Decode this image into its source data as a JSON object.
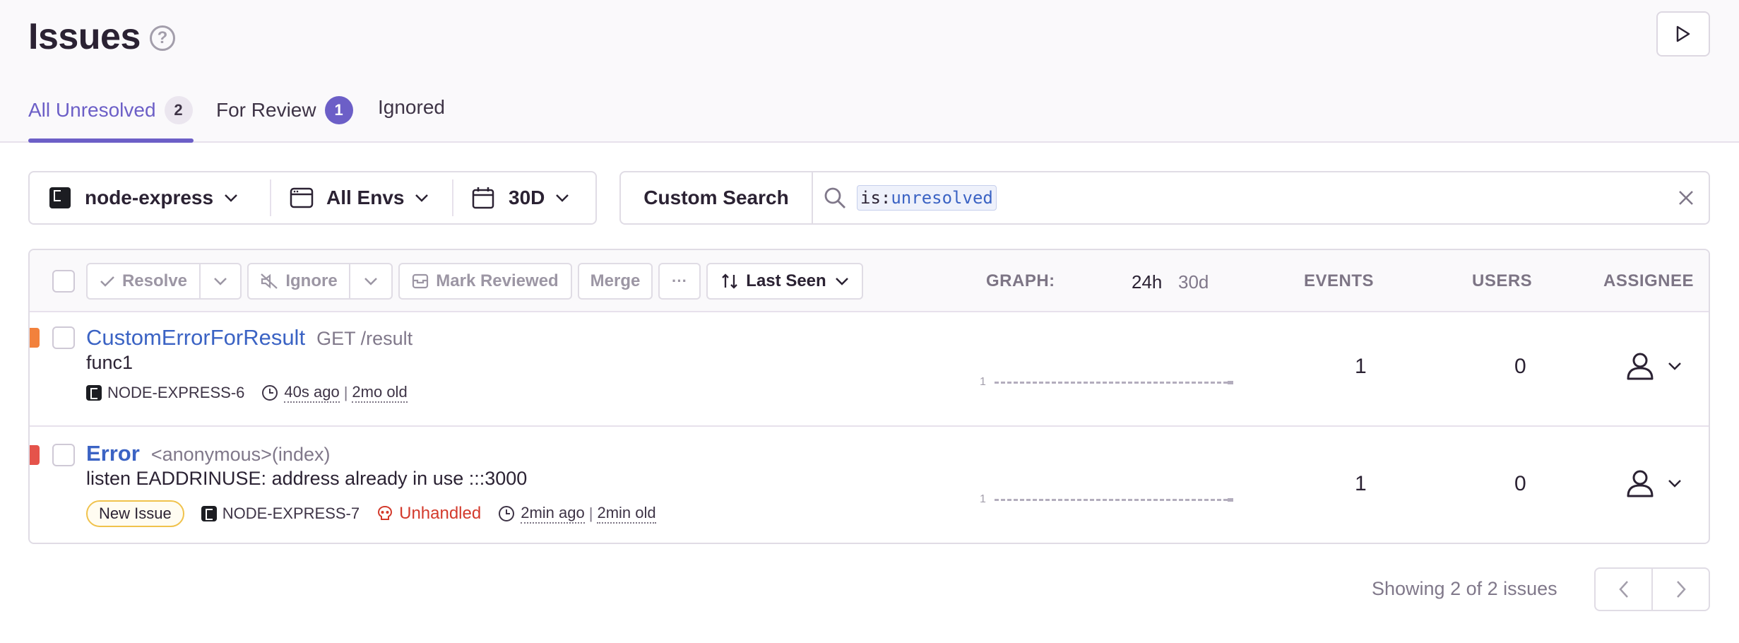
{
  "header": {
    "title": "Issues",
    "help_icon": "?",
    "tabs": [
      {
        "label": "All Unresolved",
        "count": "2"
      },
      {
        "label": "For Review",
        "count": "1"
      },
      {
        "label": "Ignored"
      }
    ]
  },
  "filters": {
    "project": "node-express",
    "environment": "All Envs",
    "period": "30D"
  },
  "search": {
    "custom_label": "Custom Search",
    "token_key": "is:",
    "token_value": "unresolved"
  },
  "toolbar": {
    "resolve": "Resolve",
    "ignore": "Ignore",
    "mark_reviewed": "Mark Reviewed",
    "merge": "Merge",
    "more": "···",
    "sort": "Last Seen",
    "graph_label": "GRAPH:",
    "graph_24h": "24h",
    "graph_30d": "30d",
    "col_events": "EVENTS",
    "col_users": "USERS",
    "col_assignee": "ASSIGNEE"
  },
  "issues": [
    {
      "title": "CustomErrorForResult",
      "subtitle": "GET /result",
      "message": "func1",
      "short_id": "NODE-EXPRESS-6",
      "last_seen": "40s ago",
      "age": "2mo old",
      "graph_max": "1",
      "events": "1",
      "users": "0",
      "level_color": "#f2813c"
    },
    {
      "title": "Error",
      "subtitle": "<anonymous>(index)",
      "message": "listen EADDRINUSE: address already in use :::3000",
      "badge": "New Issue",
      "short_id": "NODE-EXPRESS-7",
      "handled": "Unhandled",
      "last_seen": "2min ago",
      "age": "2min old",
      "graph_max": "1",
      "events": "1",
      "users": "0",
      "level_color": "#e5534b"
    }
  ],
  "pagination": {
    "summary": "Showing 2 of 2 issues"
  }
}
